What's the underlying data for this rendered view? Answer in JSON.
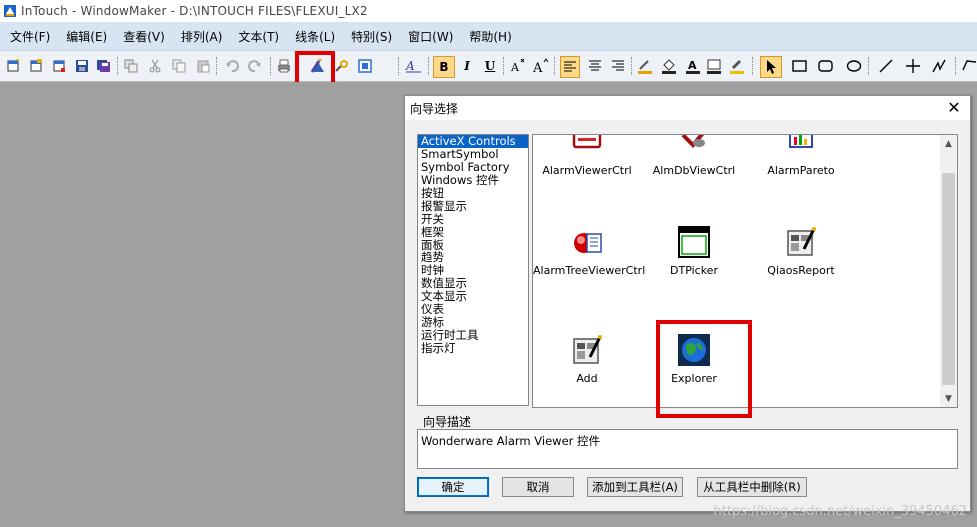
{
  "window": {
    "title": "InTouch - WindowMaker - D:\\INTOUCH FILES\\FLEXUI_LX2"
  },
  "menu": [
    "文件(F)",
    "编辑(E)",
    "查看(V)",
    "排列(A)",
    "文本(T)",
    "线条(L)",
    "特别(S)",
    "窗口(W)",
    "帮助(H)"
  ],
  "toolbar": {
    "bold": "B",
    "italic": "I",
    "underline": "U"
  },
  "dialog": {
    "title": "向导选择",
    "close": "✕",
    "categories": [
      "ActiveX Controls",
      "SmartSymbol",
      "Symbol Factory",
      "Windows 控件",
      "按钮",
      "报警显示",
      "开关",
      "框架",
      "面板",
      "趋势",
      "时钟",
      "数值显示",
      "文本显示",
      "仪表",
      "游标",
      "运行时工具",
      "指示灯"
    ],
    "selected_category": "ActiveX Controls",
    "wizards": [
      "AlarmViewerCtrl",
      "AlmDbViewCtrl",
      "AlarmPareto",
      "AlarmTreeViewerCtrl",
      "DTPicker",
      "QiaosReport",
      "Add",
      "Explorer"
    ],
    "description_label": "向导描述",
    "description": "Wonderware Alarm Viewer 控件",
    "buttons": {
      "ok": "确定",
      "cancel": "取消",
      "add_toolbar": "添加到工具栏(A)",
      "remove_toolbar": "从工具栏中删除(R)"
    }
  },
  "watermark": "https://blog.csdn.net/weixin_39450462",
  "colors": {
    "highlight": "#e00000",
    "selection": "#0a64c8",
    "menubar": "#d7e4f2"
  }
}
